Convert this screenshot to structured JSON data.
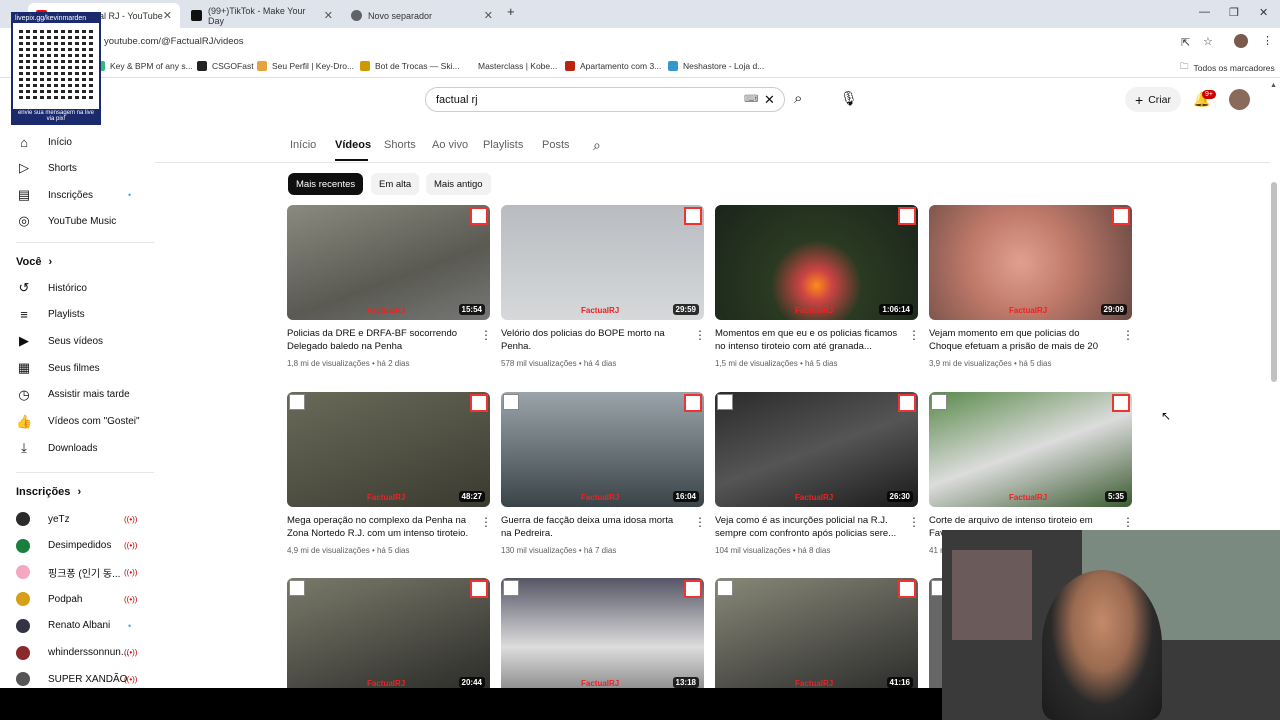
{
  "browser": {
    "tabs": [
      {
        "title": "(207) Factual RJ - YouTube",
        "fav": "#ff0000"
      },
      {
        "title": "(99+)TikTok - Make Your Day",
        "fav": "#111"
      },
      {
        "title": "Novo separador",
        "fav": "#5f6368"
      }
    ],
    "url": "youtube.com/@FactualRJ/videos",
    "bookmarks": [
      "Key & BPM of any s...",
      "CSGOFast",
      "Seu Perfil | Key-Dro...",
      "Bot de Trocas — Ski...",
      "Masterclass | Kobe...",
      "Apartamento com 3...",
      "Neshastore - Loja d..."
    ],
    "all_bookmarks": "Todos os marcadores"
  },
  "overlay": {
    "qr_header": "livepix.gg/kevinmarden",
    "qr_footer": "envie sua mensagem na live via pix!"
  },
  "search": {
    "value": "factual rj"
  },
  "header": {
    "create": "Criar",
    "notif_count": "9+"
  },
  "sidebar": {
    "main": [
      {
        "label": "Início",
        "icon": "home-icon",
        "g": "⌂"
      },
      {
        "label": "Shorts",
        "icon": "shorts-icon",
        "g": "▷"
      },
      {
        "label": "Inscrições",
        "icon": "subscriptions-icon",
        "g": "▤"
      },
      {
        "label": "YouTube Music",
        "icon": "music-icon",
        "g": "◎"
      }
    ],
    "you_title": "Você",
    "you": [
      {
        "label": "Histórico",
        "icon": "history-icon",
        "g": "↺"
      },
      {
        "label": "Playlists",
        "icon": "playlists-icon",
        "g": "≡"
      },
      {
        "label": "Seus vídeos",
        "icon": "your-videos-icon",
        "g": "▶"
      },
      {
        "label": "Seus filmes",
        "icon": "movies-icon",
        "g": "▦"
      },
      {
        "label": "Assistir mais tarde",
        "icon": "watch-later-icon",
        "g": "◷"
      },
      {
        "label": "Vídeos com \"Gostei\"",
        "icon": "like-icon",
        "g": "👍"
      },
      {
        "label": "Downloads",
        "icon": "download-icon",
        "g": "⤓"
      }
    ],
    "subs_title": "Inscrições",
    "subs": [
      {
        "label": "yeTz",
        "color": "#2b2b2b",
        "live": true
      },
      {
        "label": "Desimpedidos",
        "color": "#1a7f3c",
        "live": true
      },
      {
        "label": "핑크퐁 (인기 동...",
        "color": "#f4a7c0",
        "live": true
      },
      {
        "label": "Podpah",
        "color": "#d4a017",
        "live": true
      },
      {
        "label": "Renato Albani",
        "color": "#334",
        "dot": true
      },
      {
        "label": "whinderssonnun...",
        "color": "#8a2a2a",
        "live": true
      },
      {
        "label": "SUPER XANDÃO",
        "color": "#555",
        "live": true
      }
    ]
  },
  "channel_tabs": [
    "Início",
    "Vídeos",
    "Shorts",
    "Ao vivo",
    "Playlists",
    "Posts"
  ],
  "chips": [
    "Mais recentes",
    "Em alta",
    "Mais antigo"
  ],
  "videos": [
    {
      "title": "Policias da DRE e DRFA-BF socorrendo Delegado baledo na Penha",
      "views": "1,8 mi de visualizações",
      "age": "há 2 dias",
      "duration": "15:54",
      "bg": "linear-gradient(160deg,#8a8a80,#5a5a52 60%,#777 100%)"
    },
    {
      "title": "Velório dos policias do BOPE morto na Penha.",
      "views": "578 mil visualizações",
      "age": "há 4 dias",
      "duration": "29:59",
      "bg": "linear-gradient(180deg,#b8bcc0,#d6d8da)"
    },
    {
      "title": "Momentos em que eu e os policias ficamos no intenso tiroteio com até granada...",
      "views": "1,5 mi de visualizações",
      "age": "há 5 dias",
      "duration": "1:06:14",
      "bg": "radial-gradient(circle at 50% 70%,#ff8a1a 0,#c44 12%,#2a3a22 35%,#1b241a 100%)"
    },
    {
      "title": "Vejam momento em que policias do Choque efetuam a prisão de mais de 20 bandidos n...",
      "views": "3,9 mi de visualizações",
      "age": "há 5 dias",
      "duration": "29:09",
      "bg": "radial-gradient(circle at 45% 50%,#e0a090 0,#c07a6a 40%,#6a4a44 100%)"
    },
    {
      "title": "Mega operação no complexo da Penha na Zona Nortedo R.J. com um intenso tiroteio.",
      "views": "4,9 mi de visualizações",
      "age": "há 5 dias",
      "duration": "48:27",
      "bg": "linear-gradient(160deg,#6a6a5a,#3a3a30)"
    },
    {
      "title": "Guerra de facção deixa uma idosa morta na Pedreira.",
      "views": "130 mil visualizações",
      "age": "há 7 dias",
      "duration": "16:04",
      "bg": "linear-gradient(180deg,#9aa4aa,#3a4448)"
    },
    {
      "title": "Veja como é as incurções policial na R.J. sempre com confronto após policias sere...",
      "views": "104 mil visualizações",
      "age": "há 8 dias",
      "duration": "26:30",
      "bg": "linear-gradient(160deg,#2a2a2a,#555 50%,#1a1a1a)"
    },
    {
      "title": "Corte de arquivo de intenso tiroteio em Fav...",
      "views": "41 mil visualizações",
      "age": "",
      "duration": "5:35",
      "bg": "linear-gradient(160deg,#5a8a4a,#dcdcdc 50%,#3a5a30)"
    },
    {
      "title": "",
      "views": "",
      "age": "",
      "duration": "20:44",
      "bg": "linear-gradient(160deg,#7a7a6a,#2a2a28)"
    },
    {
      "title": "",
      "views": "",
      "age": "",
      "duration": "13:18",
      "bg": "linear-gradient(180deg,#556,#ddd 60%,#888)"
    },
    {
      "title": "",
      "views": "",
      "age": "",
      "duration": "41:16",
      "bg": "linear-gradient(160deg,#888878,#2a2a2a)"
    },
    {
      "title": "",
      "views": "",
      "age": "",
      "duration": "",
      "bg": "#666"
    }
  ],
  "watermark": {
    "a": "Factual",
    "b": "RJ"
  }
}
